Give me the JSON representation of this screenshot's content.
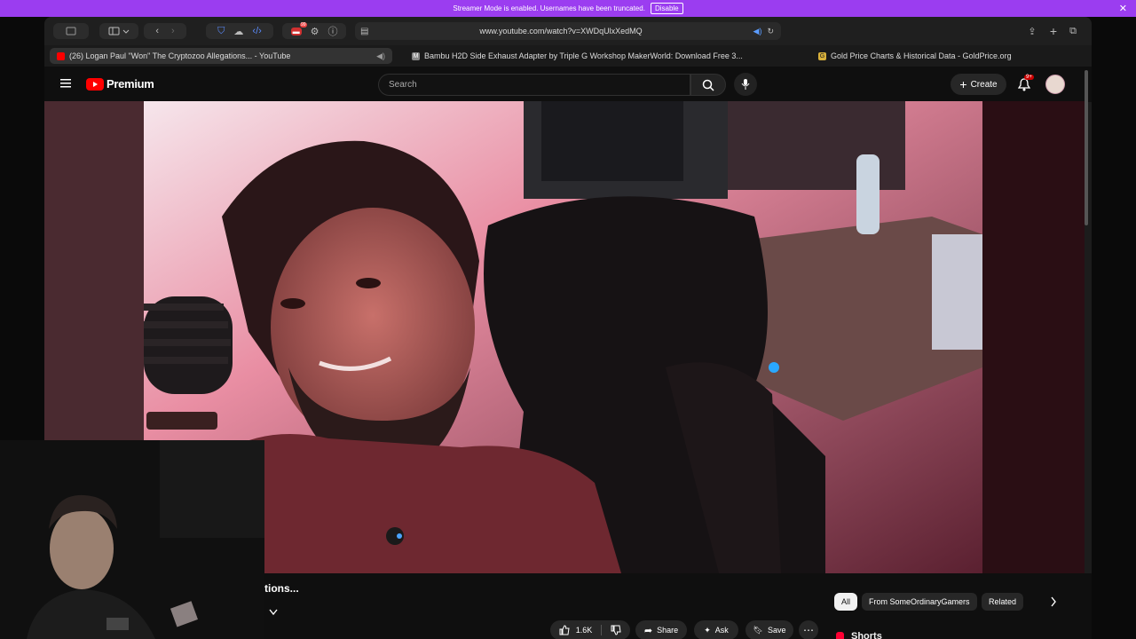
{
  "banner": {
    "text": "Streamer Mode is enabled. Usernames have been truncated.",
    "disable_label": "Disable"
  },
  "browser": {
    "url": "www.youtube.com/watch?v=XWDqUlxXedMQ",
    "tabs": [
      {
        "label": "(26) Logan Paul \"Won\" The Cryptozoo Allegations... - YouTube",
        "active": true
      },
      {
        "label": "Bambu H2D Side Exhaust Adapter by Triple G Workshop MakerWorld: Download Free 3...",
        "active": false
      },
      {
        "label": "Gold Price Charts & Historical Data - GoldPrice.org",
        "active": false
      }
    ],
    "extension_badge": "99"
  },
  "youtube": {
    "logo_text": "Premium",
    "search_placeholder": "Search",
    "create_label": "Create",
    "notification_count": "9+",
    "video_title": "tions...",
    "like_count": "1.6K",
    "share_label": "Share",
    "ask_label": "Ask",
    "save_label": "Save",
    "chips": [
      "All",
      "From SomeOrdinaryGamers",
      "Related"
    ],
    "shorts_label": "Shorts"
  },
  "colors": {
    "accent": "#ff0000",
    "banner": "#9b3df0"
  }
}
